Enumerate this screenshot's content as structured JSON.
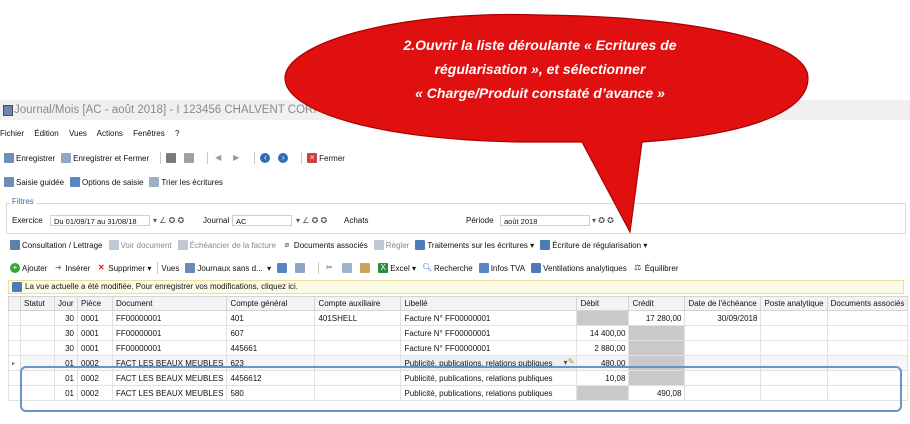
{
  "callout": {
    "line1": "2.Ouvrir la liste déroulante « Ecritures de",
    "line2": "régularisation », et sélectionner",
    "line3": "« Charge/Produit constaté d’avance »",
    "color": "#e01010"
  },
  "window": {
    "title": "Journal/Mois [AC - août 2018] - I 123456 CHALVENT CORI"
  },
  "menu": [
    "Fichier",
    "Édition",
    "Vues",
    "Actions",
    "Fenêtres",
    "?"
  ],
  "toolbar1": {
    "save": "Enregistrer",
    "save_close": "Enregistrer et Fermer",
    "close": "Fermer"
  },
  "toolbar2": {
    "guided": "Saisie guidée",
    "options": "Options de saisie",
    "sort": "Trier les écritures"
  },
  "filters": {
    "legend": "Filtres",
    "exercice_label": "Exercice",
    "exercice_value": "Du 01/09/17 au 31/08/18",
    "journal_label": "Journal",
    "journal_value": "AC",
    "journal_name": "Achats",
    "periode_label": "Période",
    "periode_value": "août 2018"
  },
  "toolbar3": {
    "consultation": "Consultation / Lettrage",
    "voir_doc": "Voir document",
    "echeancier": "Échéancier de la facture",
    "docs_associes": "Documents associés",
    "regler": "Régler",
    "traitements": "Traitements sur les écritures",
    "ecriture_reg": "Écriture de régularisation"
  },
  "toolbar4": {
    "ajouter": "Ajouter",
    "inserer": "Insérer",
    "supprimer": "Supprimer",
    "vues": "Vues",
    "journaux": "Journaux sans d...",
    "excel": "Excel",
    "recherche": "Recherche",
    "infos_tva": "Infos TVA",
    "ventilations": "Ventilations analytiques",
    "equilibrer": "Équilibrer"
  },
  "infobar": {
    "text": "La vue actuelle a été modifiée. Pour enregistrer vos modifications, cliquez ici."
  },
  "grid": {
    "columns": [
      "Statut",
      "Jour",
      "Pièce",
      "Document",
      "Compte général",
      "Compte auxiliaire",
      "Libellé",
      "Débit",
      "Crédit",
      "Date de l'échéance",
      "Poste analytique",
      "Documents associés"
    ],
    "rows": [
      {
        "statut": "",
        "jour": "30",
        "piece": "0001",
        "document": "FF00000001",
        "compte_general": "401",
        "compte_aux": "401SHELL",
        "libelle": "Facture N° FF00000001",
        "debit": "",
        "credit": "17 280,00",
        "echeance": "30/09/2018",
        "poste": "",
        "docs": ""
      },
      {
        "statut": "",
        "jour": "30",
        "piece": "0001",
        "document": "FF00000001",
        "compte_general": "607",
        "compte_aux": "",
        "libelle": "Facture N° FF00000001",
        "debit": "14 400,00",
        "credit": "",
        "echeance": "",
        "poste": "",
        "docs": ""
      },
      {
        "statut": "",
        "jour": "30",
        "piece": "0001",
        "document": "FF00000001",
        "compte_general": "445661",
        "compte_aux": "",
        "libelle": "Facture N° FF00000001",
        "debit": "2 880,00",
        "credit": "",
        "echeance": "",
        "poste": "",
        "docs": ""
      },
      {
        "statut": "",
        "jour": "01",
        "piece": "0002",
        "document": "FACT LES BEAUX MEUBLES",
        "compte_general": "623",
        "compte_aux": "",
        "libelle": "Publicité, publications, relations publiques",
        "debit": "480,00",
        "credit": "",
        "echeance": "",
        "poste": "",
        "docs": ""
      },
      {
        "statut": "",
        "jour": "01",
        "piece": "0002",
        "document": "FACT LES BEAUX MEUBLES",
        "compte_general": "4456612",
        "compte_aux": "",
        "libelle": "Publicité, publications, relations publiques",
        "debit": "10,08",
        "credit": "",
        "echeance": "",
        "poste": "",
        "docs": ""
      },
      {
        "statut": "",
        "jour": "01",
        "piece": "0002",
        "document": "FACT LES BEAUX MEUBLES",
        "compte_general": "580",
        "compte_aux": "",
        "libelle": "Publicité, publications, relations publiques",
        "debit": "",
        "credit": "490,08",
        "echeance": "",
        "poste": "",
        "docs": ""
      }
    ]
  }
}
